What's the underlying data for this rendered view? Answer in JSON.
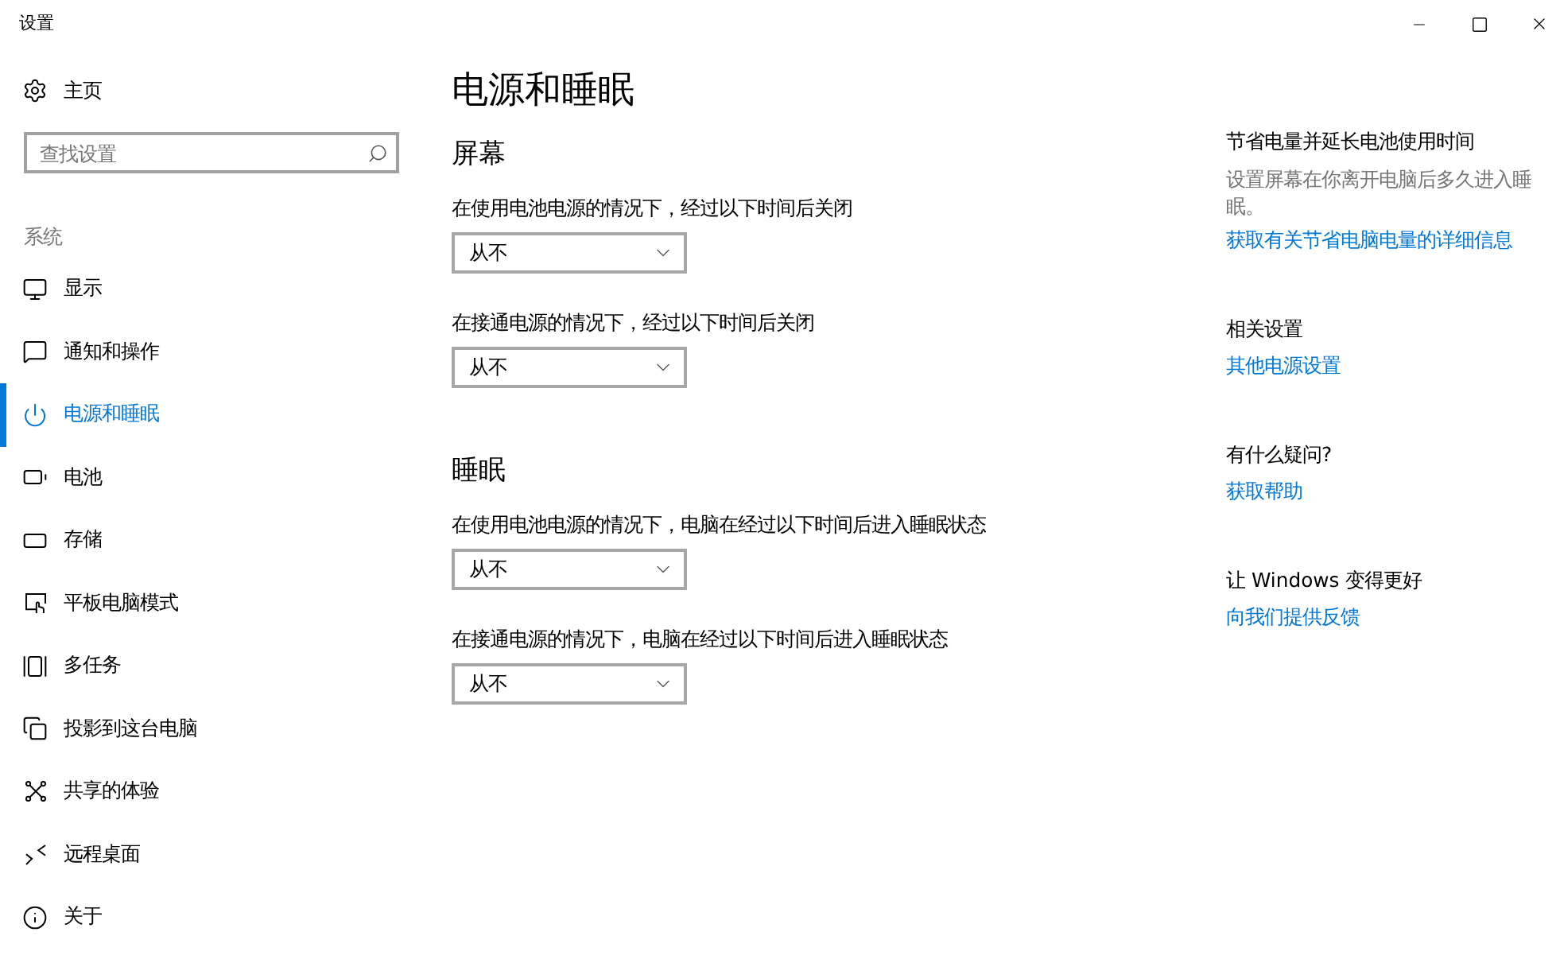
{
  "window": {
    "title": "设置"
  },
  "sidebar": {
    "home": {
      "label": "主页"
    },
    "search": {
      "placeholder": "查找设置"
    },
    "section": "系统",
    "items": [
      {
        "label": "显示",
        "selected": false
      },
      {
        "label": "通知和操作",
        "selected": false
      },
      {
        "label": "电源和睡眠",
        "selected": true
      },
      {
        "label": "电池",
        "selected": false
      },
      {
        "label": "存储",
        "selected": false
      },
      {
        "label": "平板电脑模式",
        "selected": false
      },
      {
        "label": "多任务",
        "selected": false
      },
      {
        "label": "投影到这台电脑",
        "selected": false
      },
      {
        "label": "共享的体验",
        "selected": false
      },
      {
        "label": "远程桌面",
        "selected": false
      },
      {
        "label": "关于",
        "selected": false
      }
    ]
  },
  "page": {
    "title": "电源和睡眠",
    "groups": [
      {
        "heading": "屏幕",
        "settings": [
          {
            "label": "在使用电池电源的情况下，经过以下时间后关闭",
            "value": "从不"
          },
          {
            "label": "在接通电源的情况下，经过以下时间后关闭",
            "value": "从不"
          }
        ]
      },
      {
        "heading": "睡眠",
        "settings": [
          {
            "label": "在使用电池电源的情况下，电脑在经过以下时间后进入睡眠状态",
            "value": "从不"
          },
          {
            "label": "在接通电源的情况下，电脑在经过以下时间后进入睡眠状态",
            "value": "从不"
          }
        ]
      }
    ]
  },
  "aside": {
    "sections": [
      {
        "heading": "节省电量并延长电池使用时间",
        "description": "设置屏幕在你离开电脑后多久进入睡眠。",
        "link": "获取有关节省电脑电量的详细信息"
      },
      {
        "heading": "相关设置",
        "link": "其他电源设置"
      },
      {
        "heading": "有什么疑问?",
        "link": "获取帮助"
      },
      {
        "heading": "让 Windows 变得更好",
        "link": "向我们提供反馈"
      }
    ]
  }
}
